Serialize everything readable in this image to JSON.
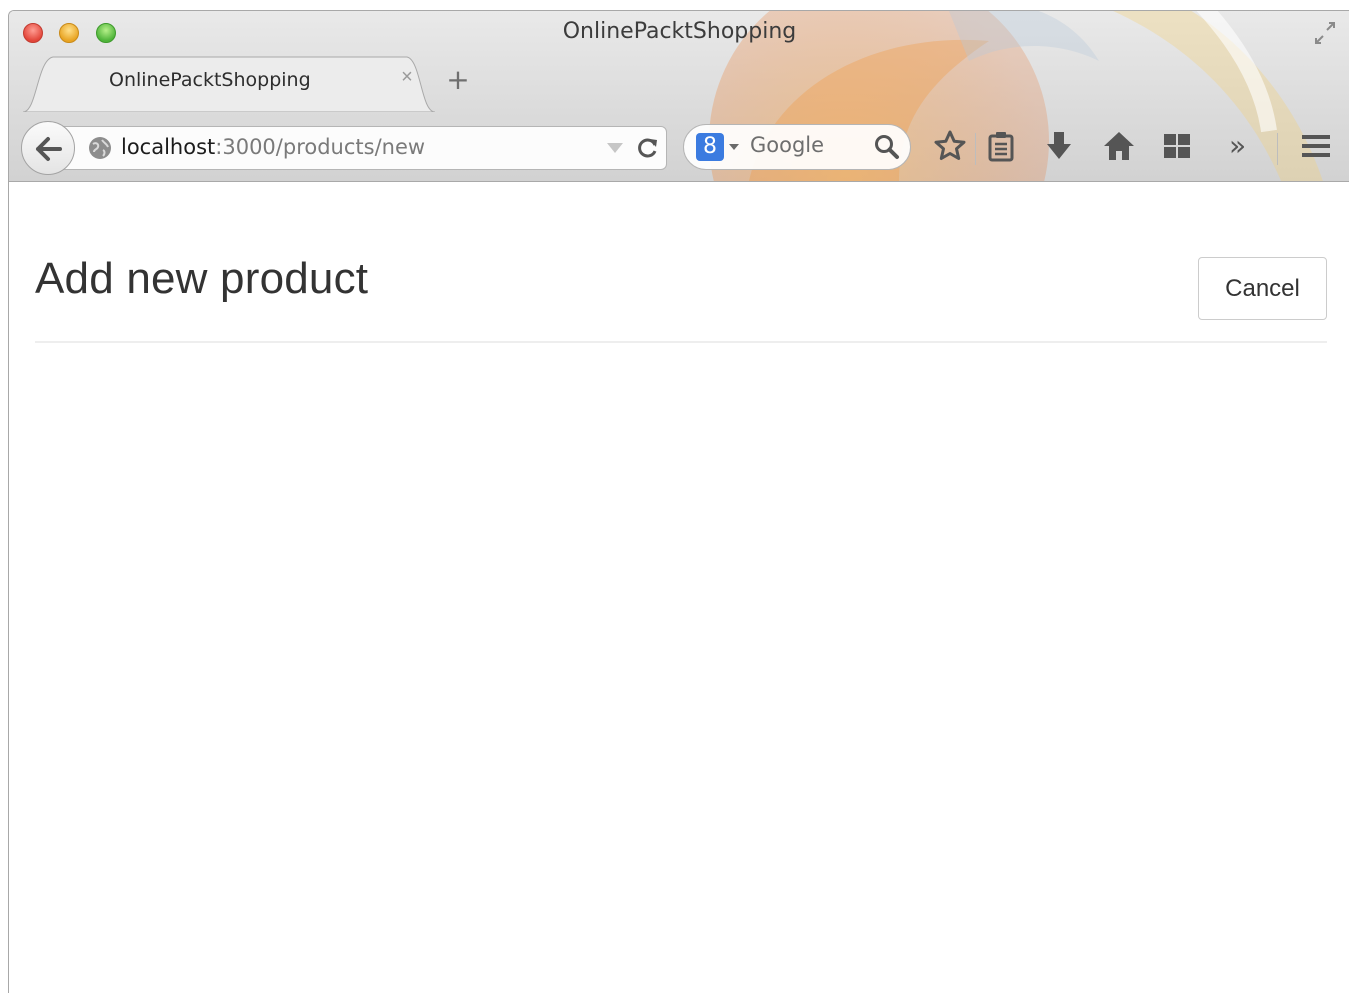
{
  "window": {
    "title": "OnlinePacktShopping"
  },
  "tabs": [
    {
      "label": "OnlinePacktShopping",
      "close_glyph": "×",
      "active": true
    }
  ],
  "new_tab_glyph": "+",
  "navbar": {
    "url_host": "localhost",
    "url_path": ":3000/products/new",
    "search_engine_glyph": "8",
    "search_placeholder": "Google",
    "overflow_glyph": "»",
    "icons": [
      "back-arrow-icon",
      "globe-icon",
      "history-dropdown-icon",
      "reload-icon",
      "search-engine-icon",
      "search-magnifier-icon",
      "bookmark-star-icon",
      "reading-list-icon",
      "downloads-icon",
      "home-icon",
      "tab-groups-icon",
      "overflow-chevron-icon",
      "menu-icon"
    ]
  },
  "page": {
    "title": "Add new product",
    "cancel_label": "Cancel"
  },
  "colors": {
    "text": "#333333",
    "button_border": "#cccccc",
    "divider": "#eeeeee",
    "search_engine": "#3b7be0"
  }
}
